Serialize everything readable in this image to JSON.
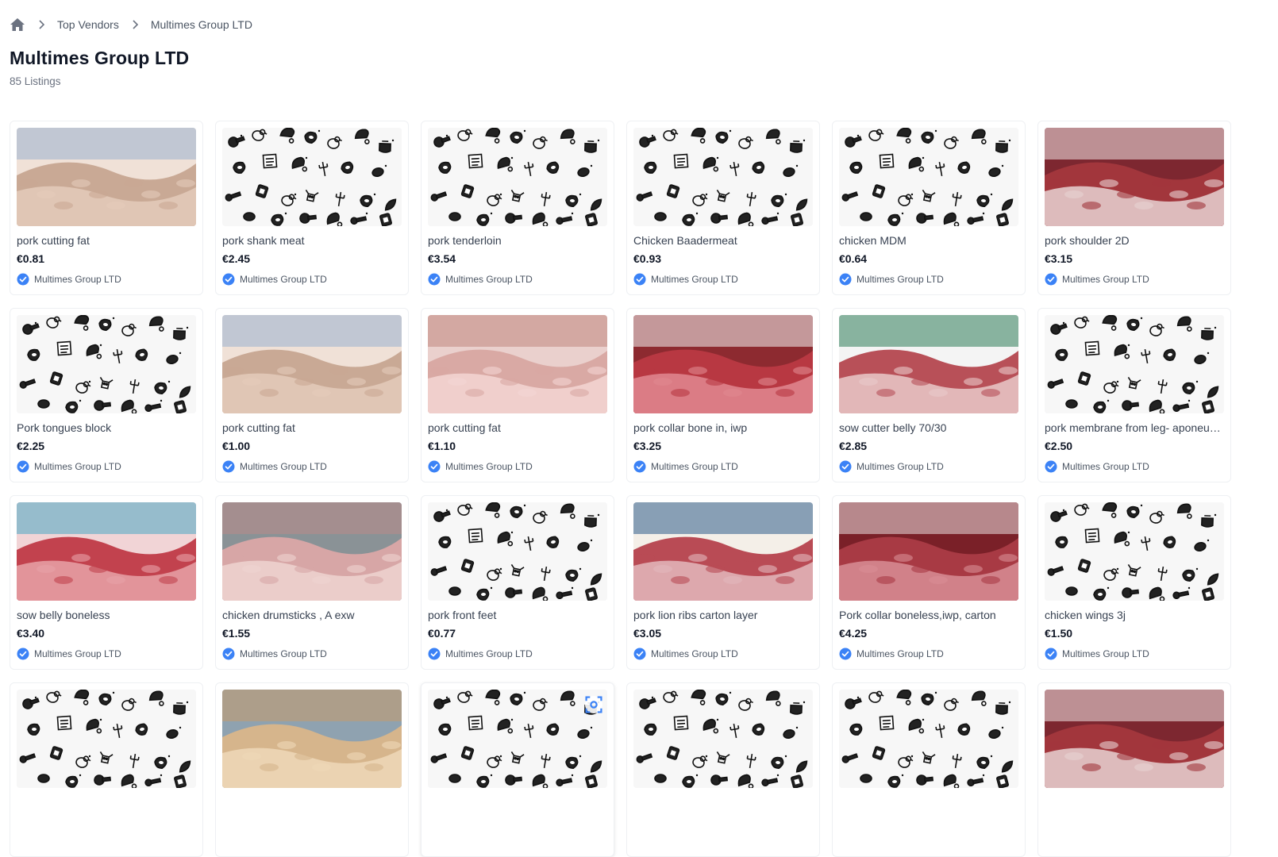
{
  "breadcrumb": {
    "home_icon": "home-icon",
    "items": [
      "Top Vendors",
      "Multimes Group LTD"
    ]
  },
  "vendor": {
    "name": "Multimes Group LTD",
    "listings": "85 Listings"
  },
  "colors": {
    "verified": "#3b82f6",
    "text_muted": "#6b7280"
  },
  "listings": [
    {
      "name": "pork cutting fat",
      "price": "€0.81",
      "vendor": "Multimes Group LTD",
      "image": "photo-fat"
    },
    {
      "name": "pork shank meat",
      "price": "€2.45",
      "vendor": "Multimes Group LTD",
      "image": "placeholder-pattern"
    },
    {
      "name": "pork tenderloin",
      "price": "€3.54",
      "vendor": "Multimes Group LTD",
      "image": "placeholder-pattern"
    },
    {
      "name": "Chicken Baadermeat",
      "price": "€0.93",
      "vendor": "Multimes Group LTD",
      "image": "placeholder-pattern"
    },
    {
      "name": "chicken MDM",
      "price": "€0.64",
      "vendor": "Multimes Group LTD",
      "image": "placeholder-pattern"
    },
    {
      "name": "pork shoulder 2D",
      "price": "€3.15",
      "vendor": "Multimes Group LTD",
      "image": "photo-shoulder"
    },
    {
      "name": "Pork tongues block",
      "price": "€2.25",
      "vendor": "Multimes Group LTD",
      "image": "placeholder-pattern"
    },
    {
      "name": "pork cutting fat",
      "price": "€1.00",
      "vendor": "Multimes Group LTD",
      "image": "photo-fat"
    },
    {
      "name": "pork cutting fat",
      "price": "€1.10",
      "vendor": "Multimes Group LTD",
      "image": "photo-fat-strips"
    },
    {
      "name": "pork collar bone in, iwp",
      "price": "€3.25",
      "vendor": "Multimes Group LTD",
      "image": "photo-collar"
    },
    {
      "name": "sow cutter belly 70/30",
      "price": "€2.85",
      "vendor": "Multimes Group LTD",
      "image": "photo-belly"
    },
    {
      "name": "pork membrane from leg- aponeurosis",
      "price": "€2.50",
      "vendor": "Multimes Group LTD",
      "image": "placeholder-pattern"
    },
    {
      "name": "sow belly boneless",
      "price": "€3.40",
      "vendor": "Multimes Group LTD",
      "image": "photo-sowbelly"
    },
    {
      "name": "chicken drumsticks , A exw",
      "price": "€1.55",
      "vendor": "Multimes Group LTD",
      "image": "photo-drumsticks"
    },
    {
      "name": "pork front feet",
      "price": "€0.77",
      "vendor": "Multimes Group LTD",
      "image": "placeholder-pattern"
    },
    {
      "name": "pork lion ribs carton layer",
      "price": "€3.05",
      "vendor": "Multimes Group LTD",
      "image": "photo-ribs"
    },
    {
      "name": "Pork collar boneless,iwp, carton",
      "price": "€4.25",
      "vendor": "Multimes Group LTD",
      "image": "photo-collar-boneless"
    },
    {
      "name": "chicken wings 3j",
      "price": "€1.50",
      "vendor": "Multimes Group LTD",
      "image": "placeholder-pattern"
    },
    {
      "name": "",
      "price": "",
      "vendor": "",
      "image": "placeholder-pattern"
    },
    {
      "name": "",
      "price": "",
      "vendor": "",
      "image": "photo-chicken-meat"
    },
    {
      "name": "",
      "price": "",
      "vendor": "",
      "image": "placeholder-pattern",
      "visual_search_icon": "visual-search-icon"
    },
    {
      "name": "",
      "price": "",
      "vendor": "",
      "image": "placeholder-pattern"
    },
    {
      "name": "",
      "price": "",
      "vendor": "",
      "image": "placeholder-pattern"
    },
    {
      "name": "",
      "price": "",
      "vendor": "",
      "image": "photo-shoulder"
    }
  ]
}
